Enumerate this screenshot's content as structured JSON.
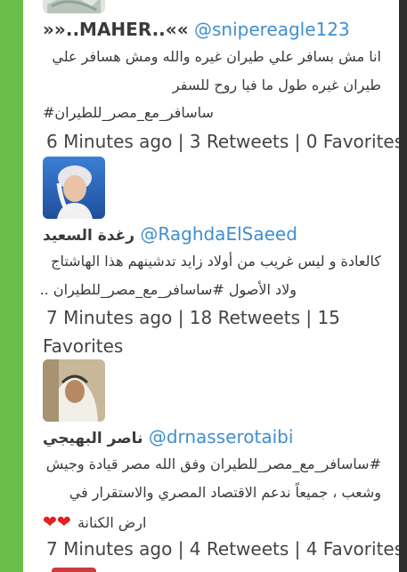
{
  "tweets": [
    {
      "name": "»»..MAHER..««",
      "handle": "@snipereagle123",
      "lines": [
        "انا مش بسافر علي طيران غيره والله ومش هسافر علي",
        "طيران غيره طول ما فيا روح للسفر",
        "#ساسافر_مع_مصر_للطيران"
      ],
      "meta": "6 Minutes ago | 3 Retweets | 0 Favorites"
    },
    {
      "name": "رغدة السعيد",
      "handle": "@RaghdaElSaeed",
      "lines": [
        "كالعادة و ليس غريب من أولاد زايد تدشينهم هذا الهاشتاج",
        "ولاد الأصول #ساسافر_مع_مصر_للطيران .."
      ],
      "meta_line1": "7 Minutes ago | 18 Retweets | 15",
      "meta_line2": "Favorites"
    },
    {
      "name": "ناصر البهيجي",
      "handle": "@drnasserotaibi",
      "lines": [
        "#ساسافر_مع_مصر_للطيران وفق الله مصر قيادة وجيش",
        "وشعب ، جميعاً ندعم الاقتصاد المصري والاستقرار في",
        "ارض الكنانة"
      ],
      "meta": "7 Minutes ago | 4 Retweets | 4 Favorites"
    }
  ],
  "colors": {
    "accent": "#3f8fd0",
    "left_bar": "#6abf4b",
    "heart": "#e02222"
  },
  "icons": [
    "heart-icon"
  ]
}
